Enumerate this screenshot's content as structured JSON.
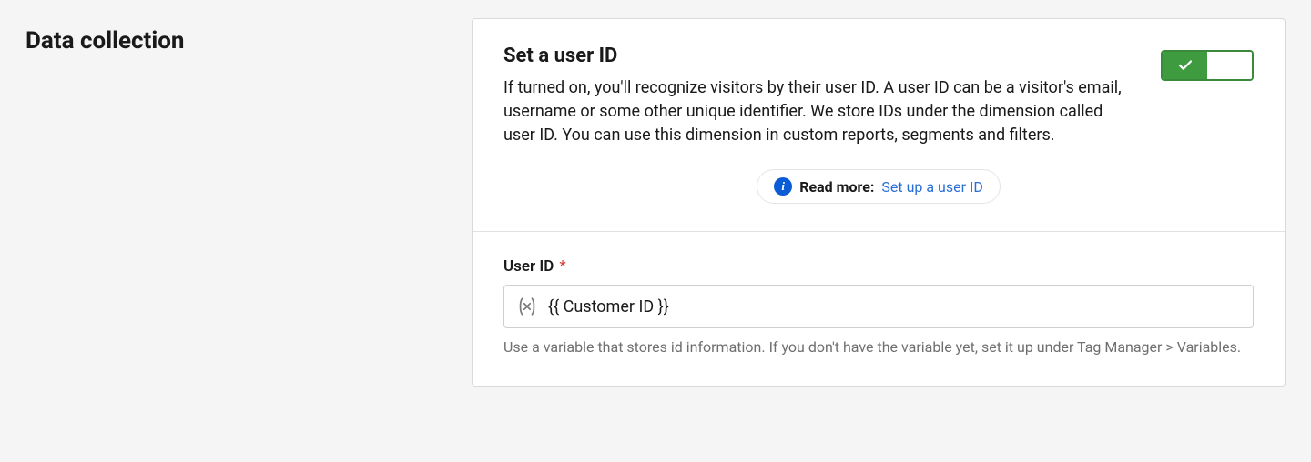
{
  "section": {
    "title": "Data collection"
  },
  "panel": {
    "setUserId": {
      "title": "Set a user ID",
      "desc": "If turned on, you'll recognize visitors by their user ID. A user ID can be a visitor's email, username or some other unique identifier. We store IDs under the dimension called user ID. You can use this dimension in custom reports, segments and filters.",
      "toggle": true
    },
    "readMore": {
      "label": "Read more:",
      "linkText": "Set up a user ID"
    },
    "userIdField": {
      "label": "User ID",
      "required": "*",
      "value": "{{ Customer ID }}",
      "help": "Use a variable that stores id information. If you don't have the variable yet, set it up under Tag Manager > Variables."
    }
  },
  "colors": {
    "toggleGreen": "#3f9b3f",
    "infoBlue": "#0a5cd6",
    "link": "#2a6fd6"
  }
}
